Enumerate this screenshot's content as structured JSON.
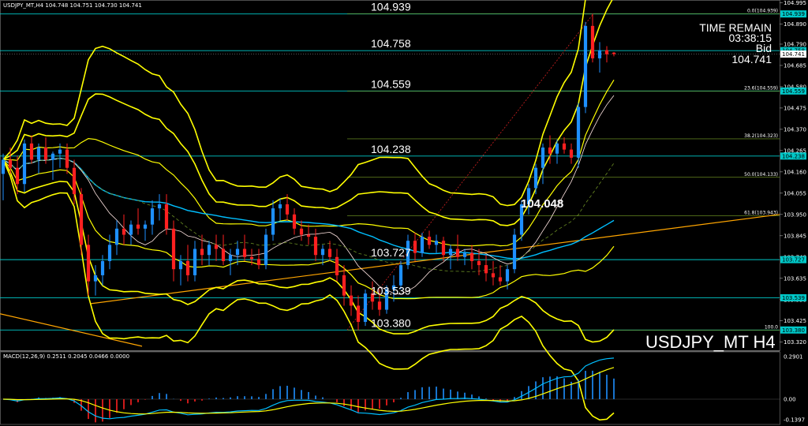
{
  "header": {
    "symbol": "USDJPY_MT,H4",
    "ohlc": "104.748 104.751 104.730 104.741"
  },
  "time_remain": {
    "title": "TIME REMAIN",
    "value": "03:38:15",
    "bid_label": "Bid",
    "bid_value": "104.741"
  },
  "watermark": "USDJPY_MT H4",
  "annotation": "104.048",
  "macd_label": "MACD(12,26,9) 0.2511 0.2045 0.0466 0.0000",
  "colors": {
    "bull": "#1e90ff",
    "bear": "#ff2020",
    "band": "#ffff00",
    "level": "#00c8c8",
    "trend": "#ffa500",
    "ma": "#00bfff"
  },
  "chart_data": [
    {
      "type": "candlestick",
      "ylim": [
        103.28,
        105.0
      ],
      "y_ticks": [
        "104.995",
        "104.890",
        "104.790",
        "104.685",
        "104.580",
        "104.475",
        "104.370",
        "104.265",
        "104.160",
        "104.055",
        "103.950",
        "103.845",
        "103.740",
        "103.635",
        "103.530",
        "103.425",
        "103.320"
      ],
      "horizontal_levels": [
        {
          "label": "104.939",
          "value": 104.939
        },
        {
          "label": "104.758",
          "value": 104.758
        },
        {
          "label": "104.559",
          "value": 104.559
        },
        {
          "label": "104.238",
          "value": 104.238
        },
        {
          "label": "103.727",
          "value": 103.727
        },
        {
          "label": "103.539",
          "value": 103.539
        },
        {
          "label": "103.380",
          "value": 103.38
        }
      ],
      "fib_levels": [
        {
          "label": "0.0(104.939)",
          "value": 104.939
        },
        {
          "label": "23.6(104.559)",
          "value": 104.559
        },
        {
          "label": "38.2(104.323)",
          "value": 104.323
        },
        {
          "label": "50.0(104.133)",
          "value": 104.133
        },
        {
          "label": "61.8(103.943)",
          "value": 103.943
        },
        {
          "label": "100.0",
          "value": 103.38
        }
      ],
      "price_tags": [
        "104.939",
        "104.758",
        "104.741",
        "104.559",
        "104.238",
        "103.727",
        "103.539",
        "103.380"
      ],
      "candles": [
        [
          104.15,
          104.25,
          104.02,
          104.22
        ],
        [
          104.22,
          104.28,
          104.15,
          104.18
        ],
        [
          104.18,
          104.24,
          104.05,
          104.1
        ],
        [
          104.1,
          104.32,
          104.06,
          104.3
        ],
        [
          104.3,
          104.34,
          104.2,
          104.22
        ],
        [
          104.22,
          104.3,
          104.15,
          104.28
        ],
        [
          104.28,
          104.33,
          104.2,
          104.22
        ],
        [
          104.22,
          104.26,
          104.12,
          104.25
        ],
        [
          104.25,
          104.3,
          104.18,
          104.27
        ],
        [
          104.27,
          104.3,
          104.15,
          104.18
        ],
        [
          104.18,
          104.22,
          104.0,
          104.05
        ],
        [
          104.05,
          104.08,
          103.75,
          103.8
        ],
        [
          103.8,
          103.85,
          103.55,
          103.62
        ],
        [
          103.62,
          103.7,
          103.55,
          103.65
        ],
        [
          103.65,
          103.75,
          103.6,
          103.72
        ],
        [
          103.72,
          103.85,
          103.68,
          103.8
        ],
        [
          103.8,
          103.92,
          103.75,
          103.88
        ],
        [
          103.88,
          103.95,
          103.8,
          103.85
        ],
        [
          103.85,
          103.92,
          103.8,
          103.9
        ],
        [
          103.9,
          103.98,
          103.85,
          103.88
        ],
        [
          103.88,
          103.92,
          103.82,
          103.9
        ],
        [
          103.9,
          104.02,
          103.85,
          103.98
        ],
        [
          103.98,
          104.05,
          103.92,
          104.0
        ],
        [
          104.0,
          104.05,
          103.85,
          103.88
        ],
        [
          103.88,
          103.92,
          103.62,
          103.68
        ],
        [
          103.68,
          103.75,
          103.6,
          103.72
        ],
        [
          103.72,
          103.8,
          103.62,
          103.65
        ],
        [
          103.65,
          103.82,
          103.62,
          103.78
        ],
        [
          103.78,
          103.85,
          103.7,
          103.75
        ],
        [
          103.75,
          103.82,
          103.7,
          103.8
        ],
        [
          103.8,
          103.85,
          103.72,
          103.78
        ],
        [
          103.78,
          103.85,
          103.7,
          103.72
        ],
        [
          103.72,
          103.78,
          103.65,
          103.75
        ],
        [
          103.75,
          103.82,
          103.7,
          103.78
        ],
        [
          103.78,
          103.85,
          103.72,
          103.74
        ],
        [
          103.74,
          103.78,
          103.7,
          103.73
        ],
        [
          103.73,
          103.78,
          103.68,
          103.7
        ],
        [
          103.7,
          103.88,
          103.68,
          103.85
        ],
        [
          103.85,
          104.02,
          103.82,
          103.98
        ],
        [
          103.98,
          104.03,
          103.92,
          104.0
        ],
        [
          104.0,
          104.05,
          103.92,
          103.95
        ],
        [
          103.95,
          103.98,
          103.85,
          103.88
        ],
        [
          103.88,
          103.92,
          103.82,
          103.85
        ],
        [
          103.85,
          103.9,
          103.8,
          103.84
        ],
        [
          103.84,
          103.88,
          103.72,
          103.75
        ],
        [
          103.75,
          103.8,
          103.7,
          103.78
        ],
        [
          103.78,
          103.82,
          103.72,
          103.74
        ],
        [
          103.74,
          103.78,
          103.62,
          103.65
        ],
        [
          103.65,
          103.7,
          103.5,
          103.55
        ],
        [
          103.55,
          103.6,
          103.45,
          103.5
        ],
        [
          103.5,
          103.55,
          103.38,
          103.42
        ],
        [
          103.42,
          103.58,
          103.4,
          103.56
        ],
        [
          103.56,
          103.62,
          103.48,
          103.52
        ],
        [
          103.52,
          103.58,
          103.45,
          103.48
        ],
        [
          103.48,
          103.6,
          103.46,
          103.58
        ],
        [
          103.58,
          103.65,
          103.52,
          103.6
        ],
        [
          103.6,
          103.72,
          103.58,
          103.7
        ],
        [
          103.7,
          103.85,
          103.68,
          103.82
        ],
        [
          103.82,
          103.86,
          103.72,
          103.76
        ],
        [
          103.76,
          103.86,
          103.74,
          103.84
        ],
        [
          103.84,
          103.87,
          103.78,
          103.8
        ],
        [
          103.8,
          103.85,
          103.76,
          103.82
        ],
        [
          103.82,
          103.84,
          103.72,
          103.75
        ],
        [
          103.75,
          103.8,
          103.68,
          103.78
        ],
        [
          103.78,
          103.85,
          103.72,
          103.74
        ],
        [
          103.74,
          103.78,
          103.7,
          103.76
        ],
        [
          103.76,
          103.8,
          103.68,
          103.72
        ],
        [
          103.72,
          103.78,
          103.65,
          103.7
        ],
        [
          103.7,
          103.75,
          103.62,
          103.66
        ],
        [
          103.66,
          103.72,
          103.6,
          103.64
        ],
        [
          103.64,
          103.7,
          103.6,
          103.62
        ],
        [
          103.62,
          103.7,
          103.58,
          103.68
        ],
        [
          103.68,
          103.88,
          103.66,
          103.85
        ],
        [
          103.85,
          104.02,
          103.82,
          104.0
        ],
        [
          104.0,
          104.1,
          103.95,
          104.08
        ],
        [
          104.08,
          104.2,
          104.05,
          104.18
        ],
        [
          104.18,
          104.3,
          104.1,
          104.28
        ],
        [
          104.28,
          104.34,
          104.2,
          104.25
        ],
        [
          104.25,
          104.32,
          104.2,
          104.3
        ],
        [
          104.3,
          104.33,
          104.25,
          104.27
        ],
        [
          104.27,
          104.3,
          104.2,
          104.23
        ],
        [
          104.23,
          104.5,
          104.18,
          104.48
        ],
        [
          104.48,
          104.9,
          104.45,
          104.88
        ],
        [
          104.88,
          104.94,
          104.7,
          104.72
        ],
        [
          104.72,
          104.8,
          104.65,
          104.76
        ],
        [
          104.76,
          104.78,
          104.7,
          104.74
        ],
        [
          104.748,
          104.751,
          104.73,
          104.741
        ]
      ]
    },
    {
      "type": "macd",
      "title": "MACD(12,26,9) 0.2511 0.2045 0.0466 0.0000",
      "ylim": [
        -0.1397,
        0.2901
      ],
      "y_ticks": [
        "0.2901",
        "0.00",
        "-0.1397"
      ]
    }
  ]
}
